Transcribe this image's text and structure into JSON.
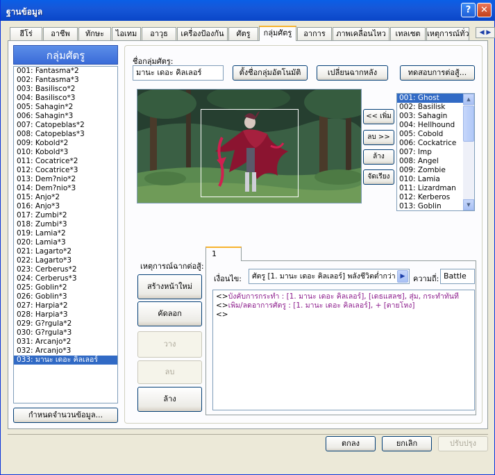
{
  "window": {
    "title": "ฐานข้อมูล",
    "help_label": "?",
    "close_label": "✕"
  },
  "tabs": [
    "ฮีโร่",
    "อาชีพ",
    "ทักษะ",
    "ไอเทม",
    "อาวุธ",
    "เครื่องป้องกัน",
    "ศัตรู",
    "กลุ่มศัตรู",
    "อาการ",
    "ภาพเคลื่อนไหว",
    "เทลเซต",
    "เหตุการณ์ทั่ว"
  ],
  "active_tab": "กลุ่มศัตรู",
  "tab_scroll": "◀ ▶",
  "sidebar": {
    "header": "กลุ่มศัตรู",
    "items": [
      "001: Fantasma*2",
      "002: Fantasma*3",
      "003: Basilisco*2",
      "004: Basilisco*3",
      "005: Sahagin*2",
      "006: Sahagin*3",
      "007: Catopeblas*2",
      "008: Catopeblas*3",
      "009: Kobold*2",
      "010: Kobold*3",
      "011: Cocatrice*2",
      "012: Cocatrice*3",
      "013: Dem?nio*2",
      "014: Dem?nio*3",
      "015: Anjo*2",
      "016: Anjo*3",
      "017: Zumbi*2",
      "018: Zumbi*3",
      "019: Lamia*2",
      "020: Lamia*3",
      "021: Lagarto*2",
      "022: Lagarto*3",
      "023: Cerberus*2",
      "024: Cerberus*3",
      "025: Goblin*2",
      "026: Goblin*3",
      "027: Harpia*2",
      "028: Harpia*3",
      "029: G?rgula*2",
      "030: G?rgula*3",
      "031: Arcanjo*2",
      "032: Arcanjo*3",
      "033: มานะ เดอะ คิลเลอร์"
    ],
    "selected_index": 32,
    "change_max_label": "กำหนดจำนวนข้อมูล..."
  },
  "group": {
    "name_label": "ชื่อกลุ่มศัตรู:",
    "name_value": "มานะ เดอะ คิลเลอร์",
    "auto_name_label": "ตั้งชื่อกลุ่มอัตโนมัติ",
    "change_bg_label": "เปลี่ยนฉากหลัง",
    "battle_test_label": "ทดสอบการต่อสู้..."
  },
  "member_buttons": {
    "add": "<< เพิ่ม",
    "remove": "ลบ >>",
    "clear": "ล้าง",
    "arrange": "จัดเรียง"
  },
  "enemies": {
    "items": [
      "001: Ghost",
      "002: Basilisk",
      "003: Sahagin",
      "004: Hellhound",
      "005: Cobold",
      "006: Cockatrice",
      "007: Imp",
      "008: Angel",
      "009: Zombie",
      "010: Lamia",
      "011: Lizardman",
      "012: Kerberos",
      "013: Goblin"
    ],
    "selected_index": 0,
    "scroll_up": "▲",
    "scroll_down": "▼"
  },
  "events": {
    "section_label": "เหตุการณ์ฉากต่อสู้:",
    "new_page_label": "สร้างหน้าใหม่",
    "copy_label": "คัดลอก",
    "paste_label": "วาง",
    "delete_label": "ลบ",
    "clear_label": "ล้าง",
    "page_tab": "1",
    "condition_label": "เงื่อนไข:",
    "condition_value": "ศัตรู [1. มานะ เดอะ คิลเลอร์] พลังชีวิตต่ำกว่า",
    "condition_arrow": "▶",
    "span_label": "ความถี่:",
    "span_value": "Battle",
    "commands": [
      {
        "marker": "<>",
        "text": "บังคับการกระทำ : [1. มานะ เดอะ คิลเลอร์], [เดธแสลช], สุ่ม, กระทำทันที"
      },
      {
        "marker": "<>",
        "text": "เพิ่ม/ลดอาการศัตรู : [1. มานะ เดอะ คิลเลอร์], + [ตายโหง]"
      },
      {
        "marker": "<>",
        "text": ""
      }
    ]
  },
  "footer": {
    "ok_label": "ตกลง",
    "cancel_label": "ยกเลิก",
    "apply_label": "ปรับปรุง"
  }
}
